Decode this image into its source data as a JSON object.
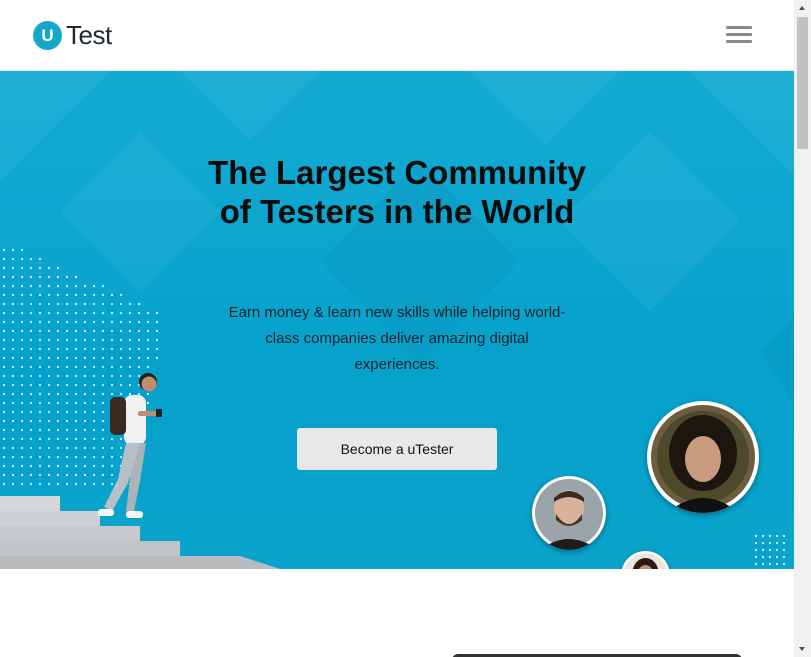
{
  "header": {
    "logo_letter": "U",
    "logo_text": "Test",
    "menu_icon": "hamburger-menu-icon"
  },
  "hero": {
    "title": "The Largest Community of Testers in the World",
    "subtitle": "Earn money & learn new skills while helping world-class companies deliver amazing digital experiences.",
    "cta_label": "Become a uTester",
    "background_color": "#0aa6cf",
    "cta_color": "#e8e8e8"
  },
  "avatars": [
    "avatar-woman-curly-hair",
    "avatar-man-beard",
    "avatar-woman-small"
  ]
}
